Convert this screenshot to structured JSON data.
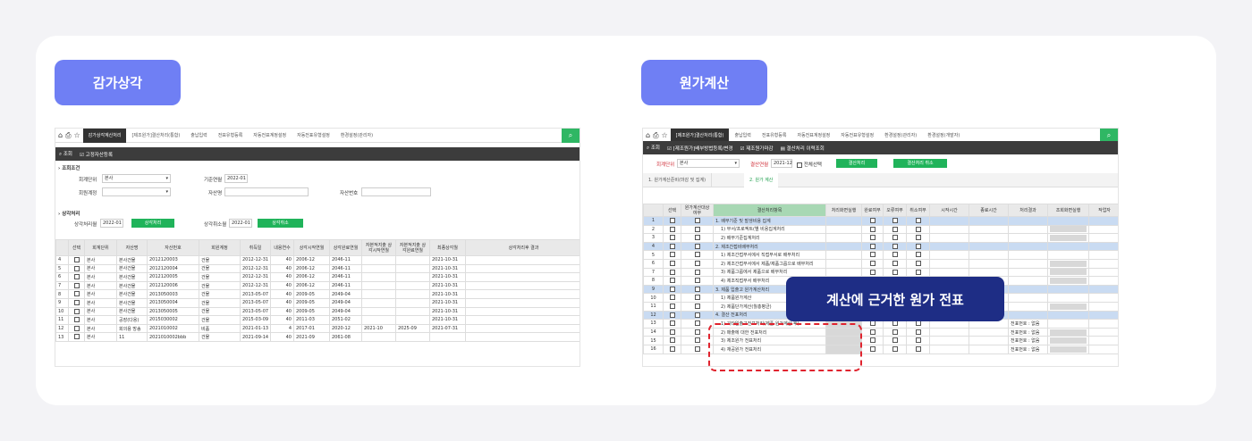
{
  "left": {
    "badge": "감가상각",
    "tabs": [
      "감가상각계산처리",
      "[제조원가]결산처리(통합)",
      "출납입력",
      "전표유형등록",
      "자동전표계정설정",
      "자동전표유형설정",
      "환경설정(관리자)"
    ],
    "toolbar": [
      "조회",
      "고정자산등록"
    ],
    "cond": {
      "title": "조회조건",
      "unit_label": "회계단위",
      "unit_value": "본사",
      "ym_label": "기준연월",
      "ym_value": "2022-01",
      "acct_label": "회원계정",
      "asset_name_label": "자산명",
      "asset_no_label": "자산번호"
    },
    "proc": {
      "title": "상각처리",
      "ym_label": "상각처리월",
      "ym_value": "2022-01",
      "run": "상각처리",
      "cancel_label": "상각취소월",
      "cancel_value": "2022-01",
      "cancel": "상각취소"
    },
    "headers": [
      "",
      "선택",
      "회계단위",
      "자산명",
      "자산번호",
      "회원계정",
      "취득일",
      "내용연수",
      "상각시작연월",
      "상각완료연월",
      "자본적지출 상각시작연월",
      "자본적지출 상각완료연월",
      "최종상각월",
      "상각처리후 결과"
    ],
    "rows": [
      [
        "4",
        "본사",
        "본사건물",
        "2012120003",
        "건물",
        "2012-12-31",
        "40",
        "2006-12",
        "2046-11",
        "",
        "",
        "2021-10-31"
      ],
      [
        "5",
        "본사",
        "본사건물",
        "2012120004",
        "건물",
        "2012-12-31",
        "40",
        "2006-12",
        "2046-11",
        "",
        "",
        "2021-10-31"
      ],
      [
        "6",
        "본사",
        "본사건물",
        "2012120005",
        "건물",
        "2012-12-31",
        "40",
        "2006-12",
        "2046-11",
        "",
        "",
        "2021-10-31"
      ],
      [
        "7",
        "본사",
        "본사건물",
        "2012120006",
        "건물",
        "2012-12-31",
        "40",
        "2006-12",
        "2046-11",
        "",
        "",
        "2021-10-31"
      ],
      [
        "8",
        "본사",
        "본사건물",
        "2013050003",
        "건물",
        "2013-05-07",
        "40",
        "2009-05",
        "2049-04",
        "",
        "",
        "2021-10-31"
      ],
      [
        "9",
        "본사",
        "본사건물",
        "2013050004",
        "건물",
        "2013-05-07",
        "40",
        "2009-05",
        "2049-04",
        "",
        "",
        "2021-10-31"
      ],
      [
        "10",
        "본사",
        "본사건물",
        "2013050005",
        "건물",
        "2013-05-07",
        "40",
        "2009-05",
        "2049-04",
        "",
        "",
        "2021-10-31"
      ],
      [
        "11",
        "본사",
        "공장(다용)",
        "2015030002",
        "건물",
        "2015-03-09",
        "40",
        "2011-03",
        "2051-02",
        "",
        "",
        "2021-10-31"
      ],
      [
        "12",
        "본사",
        "회의용 방송",
        "2021010002",
        "비품",
        "2021-01-13",
        "4",
        "2017-01",
        "2020-12",
        "2021-10",
        "2025-09",
        "2021-07-31"
      ],
      [
        "13",
        "본사",
        "11",
        "2021010002bbb",
        "건물",
        "2021-09-14",
        "40",
        "2021-09",
        "2061-08",
        "",
        "",
        ""
      ]
    ]
  },
  "right": {
    "badge": "원가계산",
    "tabs": [
      "[제조원가]결산처리(통합)",
      "출납입력",
      "전표유형등록",
      "자동전표계정설정",
      "자동전표유형설정",
      "환경설정(관리자)",
      "환경설정(개발자)"
    ],
    "toolbar": [
      "조회",
      "[제조원가]배부방법등록/변경",
      "제조원가마감",
      "결산처리 이력조회"
    ],
    "cond": {
      "unit_label": "회계단위",
      "unit_value": "본사",
      "ym_label": "결산연월",
      "ym_value": "2021-12",
      "sel_label": "전체선택",
      "run": "결산처리",
      "cancel": "결산처리 취소"
    },
    "steps": [
      "1. 원가계산준비(마감 및 집계)",
      "2. 원가 계산"
    ],
    "headers": [
      "",
      "선택",
      "원가계산대상 여부",
      "결산처리항목",
      "처리화면실행",
      "완료여부",
      "오류여부",
      "취소여부",
      "시작시간",
      "종료시간",
      "처리결과",
      "조회화면실행",
      "작업자"
    ],
    "rows": [
      [
        "1",
        "1. 배부기준 및 발생비용 집계",
        "s"
      ],
      [
        "2",
        "1) 부서/프로젝트(별 비용집계처리",
        "n"
      ],
      [
        "3",
        "2) 배부기준집계처리",
        "n"
      ],
      [
        "4",
        "2. 제조간접비배부처리",
        "s"
      ],
      [
        "5",
        "1) 제조간접부서에서 직접부서로 배부처리",
        "n"
      ],
      [
        "6",
        "2) 제조간접부서에서 제품/제품그룹으로 배부처리",
        "n"
      ],
      [
        "7",
        "3) 제품그룹에서 제품으로 배부처리",
        "n"
      ],
      [
        "8",
        "4) 제조직접부서 배부처리",
        "n"
      ],
      [
        "9",
        "3. 제품 입출고 원가계산처리",
        "s"
      ],
      [
        "10",
        "1) 제품원가계산",
        "n"
      ],
      [
        "11",
        "2) 제품단가계산(월총평균)",
        "n"
      ],
      [
        "12",
        "4. 결산 전표처리",
        "s"
      ],
      [
        "13",
        "1) 기타입출고전표처리(제품·원가계산 후)",
        "n"
      ],
      [
        "14",
        "2) 매출에 대한 전표처리",
        "n"
      ],
      [
        "15",
        "3) 제조원가 전표처리",
        "n"
      ],
      [
        "16",
        "4) 재공원가 전표처리",
        "n"
      ]
    ],
    "result_text": "전표번호 : 없음",
    "callout": "계산에 근거한 원가 전표"
  }
}
